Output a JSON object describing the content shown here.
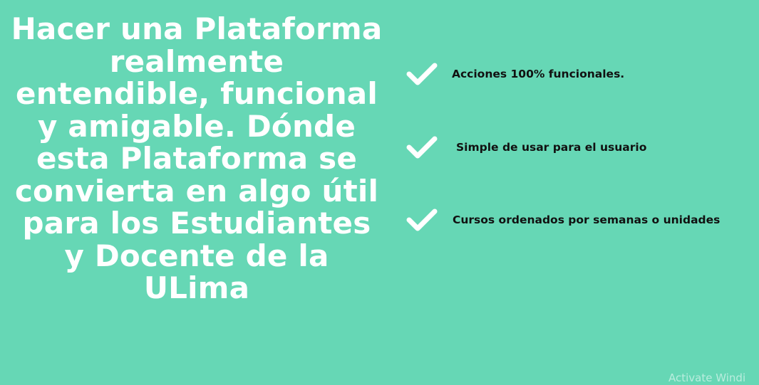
{
  "headline": {
    "text": "Hacer una Plataforma realmente entendible, funcional y amigable. Dónde esta Plataforma se convierta en algo útil para los Estudiantes y Docente de la ULima"
  },
  "features": [
    {
      "icon": "checkmark-icon",
      "label": "Acciones 100% funcionales."
    },
    {
      "icon": "checkmark-icon",
      "label": "Simple de usar para el usuario"
    },
    {
      "icon": "checkmark-icon",
      "label": "Cursos ordenados por semanas o unidades"
    }
  ],
  "watermark": {
    "text": "Activate Windi"
  },
  "colors": {
    "background": "#66d7b5",
    "headline": "#ffffff",
    "feature_text": "#111111",
    "check": "#ffffff"
  }
}
